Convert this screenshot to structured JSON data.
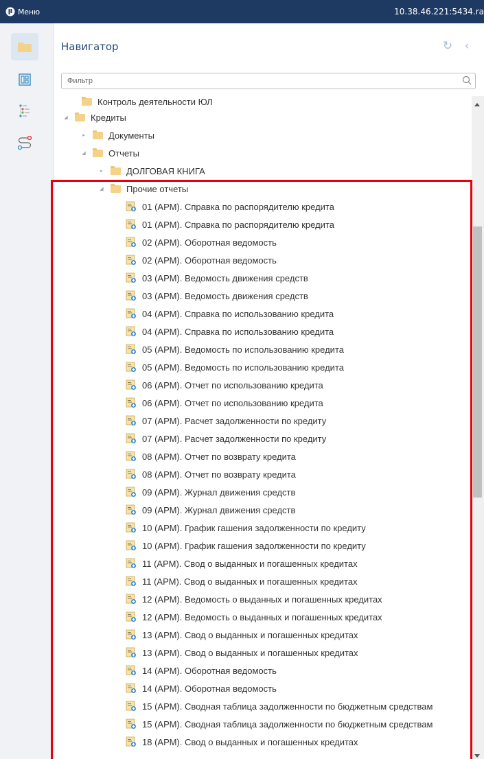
{
  "topbar": {
    "menu_label": "Меню",
    "server": "10.38.46.221:5434.ra"
  },
  "navigator": {
    "title": "Навигатор",
    "filter_placeholder": "Фильтр"
  },
  "tree": {
    "cut_item": "Контроль деятельности ЮЛ",
    "credits": "Кредиты",
    "documents": "Документы",
    "reports": "Отчеты",
    "debt_book": "ДОЛГОВАЯ КНИГА",
    "other_reports": "Прочие отчеты",
    "report_items": [
      "01 (АРМ). Справка по распорядителю кредита",
      "01 (АРМ). Справка по распорядителю кредита",
      "02 (АРМ). Оборотная ведомость",
      "02 (АРМ). Оборотная ведомость",
      "03 (АРМ). Ведомость движения средств",
      "03 (АРМ). Ведомость движения средств",
      "04 (АРМ). Справка по использованию кредита",
      "04 (АРМ). Справка по использованию кредита",
      "05 (АРМ). Ведомость по использованию кредита",
      "05 (АРМ). Ведомость по использованию кредита",
      "06 (АРМ). Отчет по использованию кредита",
      "06 (АРМ). Отчет по использованию кредита",
      "07 (АРМ). Расчет задолженности по кредиту",
      "07 (АРМ). Расчет задолженности по кредиту",
      "08 (АРМ). Отчет по возврату кредита",
      "08 (АРМ). Отчет по возврату кредита",
      "09 (АРМ). Журнал движения средств",
      "09 (АРМ). Журнал движения средств",
      "10 (АРМ). График гашения задолженности по кредиту",
      "10 (АРМ). График гашения задолженности по кредиту",
      "11 (АРМ). Свод о выданных и погашенных кредитах",
      "11 (АРМ). Свод о выданных и погашенных кредитах",
      "12 (АРМ). Ведомость о выданных и погашенных кредитах",
      "12 (АРМ). Ведомость о выданных и погашенных кредитах",
      "13 (АРМ). Свод о выданных и погашенных кредитах",
      "13 (АРМ). Свод о выданных и погашенных кредитах",
      "14 (АРМ). Оборотная ведомость",
      "14 (АРМ). Оборотная ведомость",
      "15 (АРМ). Сводная таблица задолженности по бюджетным средствам",
      "15 (АРМ). Сводная таблица задолженности по бюджетным средствам",
      "18 (АРМ). Свод о выданных и погашенных кредитах"
    ]
  },
  "icons": {
    "menu": "menu-logo-icon",
    "folder": "folder-icon",
    "layout": "layout-icon",
    "tree": "tree-icon",
    "route": "route-icon",
    "refresh": "refresh-icon",
    "collapse": "chevron-left-icon",
    "search": "search-icon",
    "report": "report-icon"
  },
  "colors": {
    "topbar": "#1e3a63",
    "title": "#2b4c7e",
    "folder": "#f5d28a",
    "highlight": "#e8000b"
  }
}
